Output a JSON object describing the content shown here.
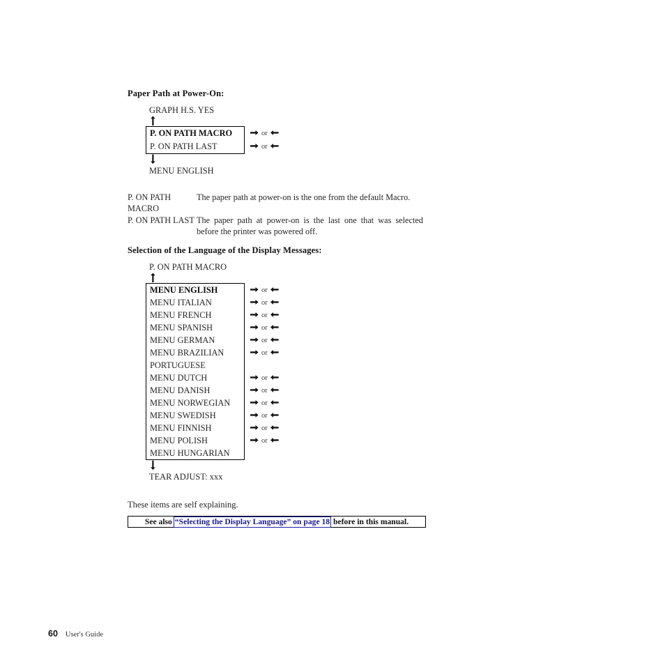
{
  "page": {
    "number": "60",
    "doc_title": "User's Guide"
  },
  "sections": [
    {
      "heading": "Paper Path at Power-On:",
      "flow": {
        "prev_item": "GRAPH H.S. YES",
        "next_item": "MENU ENGLISH",
        "up_arrow": "up-arrow-icon",
        "down_arrow": "down-arrow-icon",
        "rows": [
          {
            "label": "P. ON PATH MACRO",
            "bold": true,
            "arrows": "right-arrow-icon or left-arrow-icon",
            "or_word": "or",
            "has_arrows": true
          },
          {
            "label": "P. ON PATH LAST",
            "bold": false,
            "arrows": "right-arrow-icon or left-arrow-icon",
            "or_word": "or",
            "has_arrows": true
          }
        ]
      },
      "descriptions": [
        {
          "term": "P. ON PATH\nMACRO",
          "definition": "The paper path at power-on is the one from the default Macro."
        },
        {
          "term": "P. ON PATH LAST",
          "definition": "The paper path at power-on is the last one that was selected before the printer was powered off."
        }
      ]
    },
    {
      "heading": "Selection of the Language of the Display Messages:",
      "flow": {
        "prev_item": "P. ON PATH MACRO",
        "next_item": "TEAR ADJUST: xxx",
        "up_arrow": "up-arrow-icon",
        "down_arrow": "down-arrow-icon",
        "rows": [
          {
            "label": "MENU ENGLISH",
            "bold": true,
            "or_word": "or",
            "has_arrows": true
          },
          {
            "label": "MENU ITALIAN",
            "bold": false,
            "or_word": "or",
            "has_arrows": true
          },
          {
            "label": "MENU FRENCH",
            "bold": false,
            "or_word": "or",
            "has_arrows": true
          },
          {
            "label": "MENU SPANISH",
            "bold": false,
            "or_word": "or",
            "has_arrows": true
          },
          {
            "label": "MENU GERMAN",
            "bold": false,
            "or_word": "or",
            "has_arrows": true
          },
          {
            "label": "MENU BRAZILIAN\nPORTUGUESE",
            "bold": false,
            "or_word": "or",
            "has_arrows": true
          },
          {
            "label": "MENU DUTCH",
            "bold": false,
            "or_word": "or",
            "has_arrows": true
          },
          {
            "label": "MENU DANISH",
            "bold": false,
            "or_word": "or",
            "has_arrows": true
          },
          {
            "label": "MENU NORWEGIAN",
            "bold": false,
            "or_word": "or",
            "has_arrows": true
          },
          {
            "label": "MENU SWEDISH",
            "bold": false,
            "or_word": "or",
            "has_arrows": true
          },
          {
            "label": "MENU FINNISH",
            "bold": false,
            "or_word": "or",
            "has_arrows": true
          },
          {
            "label": "MENU POLISH",
            "bold": false,
            "or_word": "or",
            "has_arrows": true
          },
          {
            "label": "MENU HUNGARIAN",
            "bold": false,
            "or_word": "",
            "has_arrows": false
          }
        ]
      },
      "closing_note": "These items are self explaining."
    }
  ],
  "see_also": {
    "prefix": "See also",
    "link_text": "“Selecting the Display Language” on page 18",
    "suffix": "before in this manual.",
    "link_color": "#1a1a8c"
  }
}
